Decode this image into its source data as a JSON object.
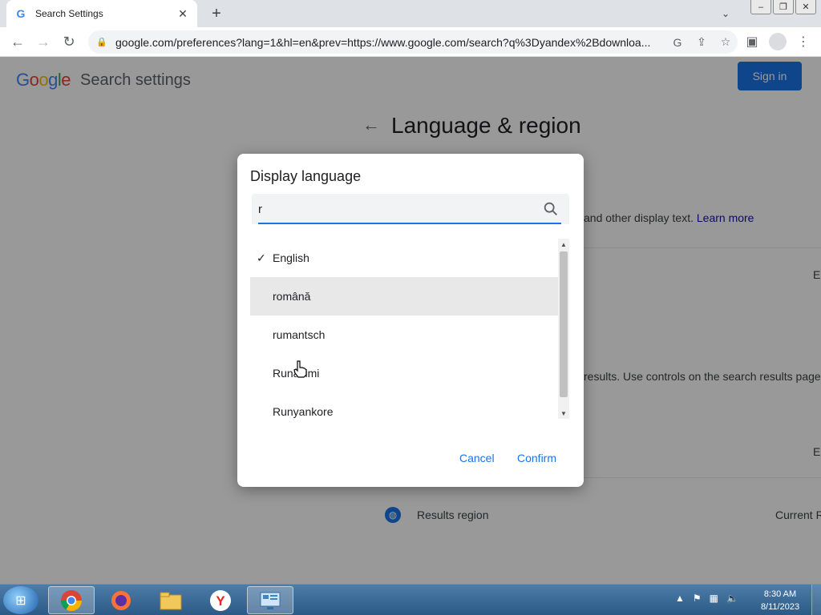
{
  "browser": {
    "tab_title": "Search Settings",
    "tab_close": "✕",
    "new_tab": "+",
    "url": "google.com/preferences?lang=1&hl=en&prev=https://www.google.com/search?q%3Dyandex%2Bdownloa..."
  },
  "page": {
    "logo_letters": [
      "G",
      "o",
      "o",
      "g",
      "l",
      "e"
    ],
    "logo_colors": [
      "#4285f4",
      "#ea4335",
      "#fbbc05",
      "#4285f4",
      "#34a853",
      "#ea4335"
    ],
    "heading": "Search settings",
    "signin_label": "Sign in",
    "section_title": "Language & region",
    "display_text_hint": "and other display text.",
    "learn_more": "Learn more",
    "results_hint": "results. Use controls on the search results page",
    "right_letter_1": "E",
    "right_letter_2": "E",
    "results_region_label": "Results region",
    "results_region_value": "Current R"
  },
  "dialog": {
    "title": "Display language",
    "search_value": "r",
    "languages": [
      {
        "label": "English",
        "selected": true
      },
      {
        "label": "română",
        "selected": false
      },
      {
        "label": "rumantsch",
        "selected": false
      },
      {
        "label": "Runasimi",
        "selected": false
      },
      {
        "label": "Runyankore",
        "selected": false
      }
    ],
    "hovered_index": 1,
    "cancel_label": "Cancel",
    "confirm_label": "Confirm"
  },
  "taskbar": {
    "time": "8:30 AM",
    "date": "8/11/2023"
  },
  "colors": {
    "accent": "#1a73e8",
    "taskbar": "#2c5a86"
  }
}
